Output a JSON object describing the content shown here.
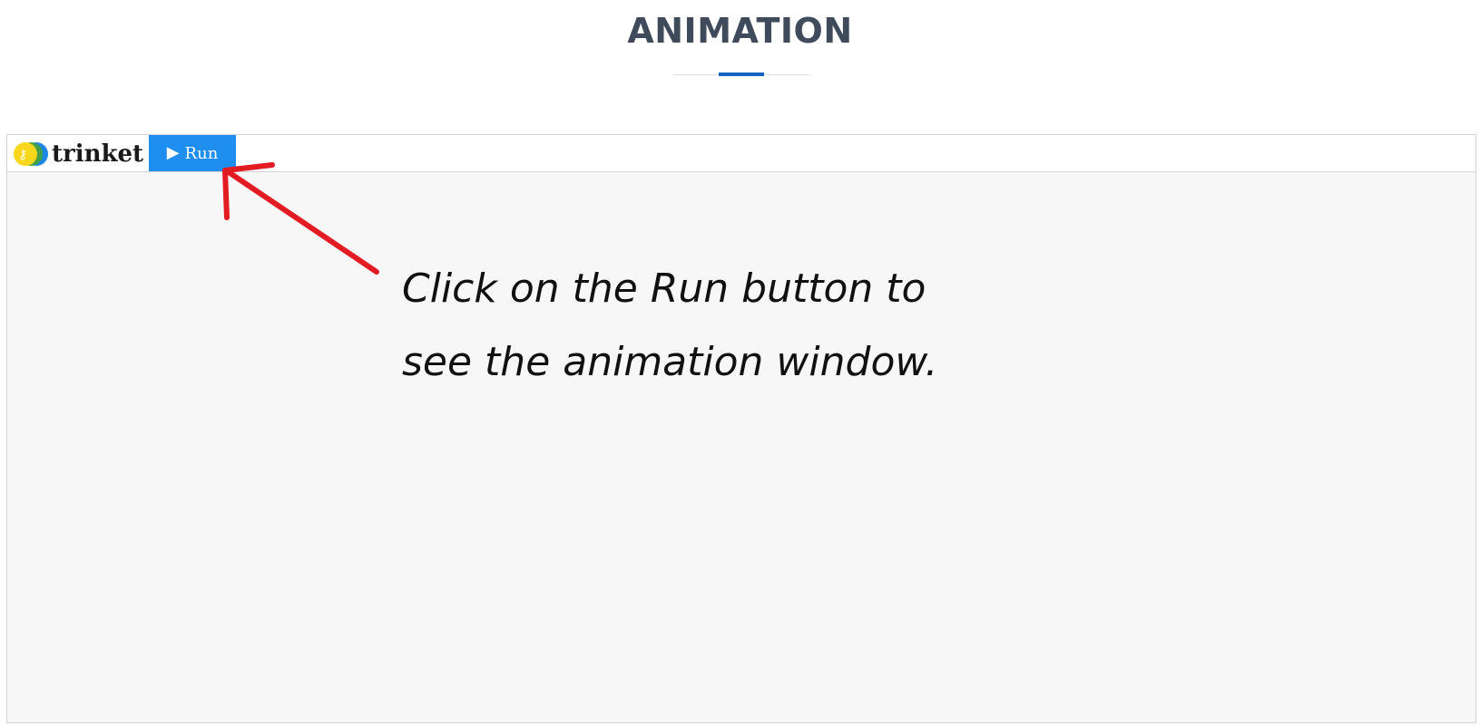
{
  "page": {
    "title": "ANIMATION",
    "accent_color": "#1565c0"
  },
  "trinket": {
    "logo_text": "trinket",
    "logo_icon": "trinket-key-logo",
    "run_button": {
      "label": "Run",
      "icon": "play-icon",
      "color": "#1f8ef1"
    },
    "canvas_background": "#f7f7f7"
  },
  "annotation": {
    "line1": "Click on the Run button to",
    "line2": "see the animation window.",
    "arrow_color": "#e31b23"
  }
}
